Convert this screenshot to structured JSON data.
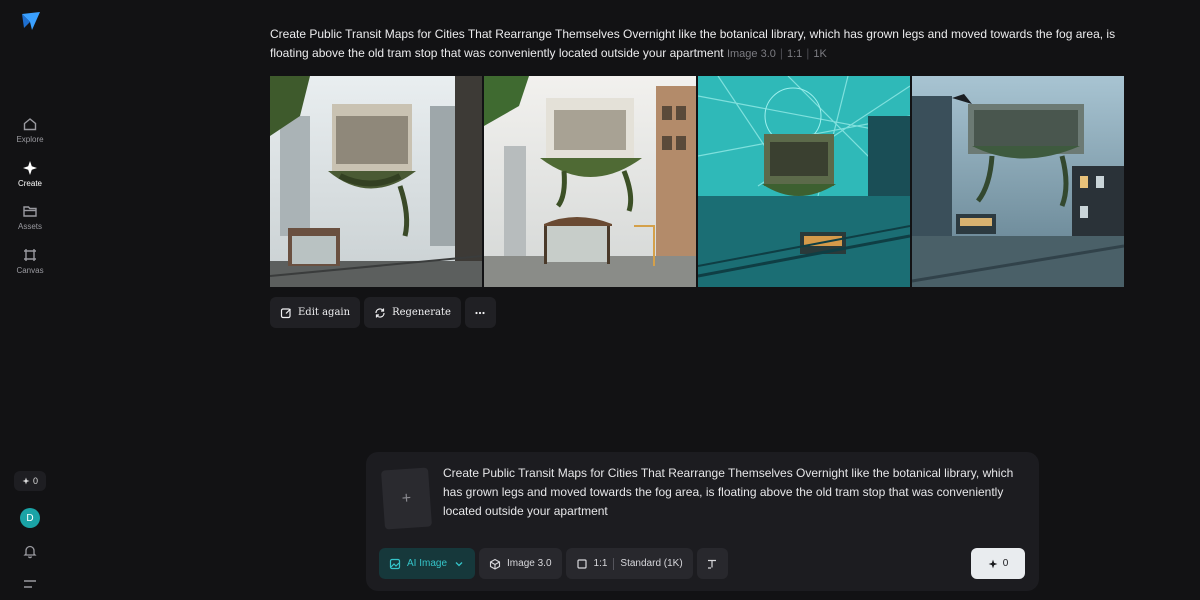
{
  "sidebar": {
    "items": [
      {
        "label": "Explore",
        "icon": "home-icon"
      },
      {
        "label": "Create",
        "icon": "sparkle-icon"
      },
      {
        "label": "Assets",
        "icon": "folder-icon"
      },
      {
        "label": "Canvas",
        "icon": "canvas-icon"
      }
    ],
    "credits": "0",
    "avatar_initial": "D"
  },
  "result": {
    "prompt": "Create Public Transit Maps for Cities That Rearrange Themselves Overnight like the botanical library, which has grown legs and moved towards the fog area, is floating above the old tram stop that was conveniently located outside your apartment",
    "model": "Image 3.0",
    "ratio": "1:1",
    "resolution": "1K",
    "images": [
      {
        "alt": "floating library building over tram stop in fog"
      },
      {
        "alt": "floating library building over bus shelter on street"
      },
      {
        "alt": "teal map-styled city with floating building and tram"
      },
      {
        "alt": "walking building with legs over foggy tram stop"
      }
    ],
    "actions": {
      "edit_again": "Edit again",
      "regenerate": "Regenerate"
    }
  },
  "composer": {
    "prompt_text": "Create Public Transit Maps for Cities That Rearrange Themselves Overnight like the botanical library, which has grown legs and moved towards the fog area, is floating above the old tram stop that was conveniently located outside your apartment",
    "mode_label": "AI Image",
    "model_label": "Image 3.0",
    "ratio_label": "1:1",
    "quality_label": "Standard (1K)",
    "generate_cost": "0"
  },
  "colors": {
    "background": "#121214",
    "accent": "#35c4c9",
    "avatar": "#1aa3a6"
  }
}
